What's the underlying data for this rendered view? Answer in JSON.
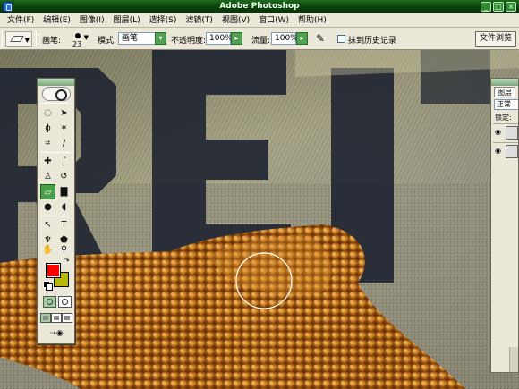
{
  "window": {
    "title": "Adobe Photoshop",
    "controls": [
      "_",
      "□",
      "×"
    ]
  },
  "menu": [
    "文件(F)",
    "编辑(E)",
    "图像(I)",
    "图层(L)",
    "选择(S)",
    "滤镜(T)",
    "视图(V)",
    "窗口(W)",
    "帮助(H)"
  ],
  "options": {
    "brush_label": "画笔:",
    "brush_size": "23",
    "mode_label": "模式:",
    "mode_value": "画笔",
    "opacity_label": "不透明度:",
    "opacity_value": "100%",
    "flow_label": "流量:",
    "flow_value": "100%",
    "erase_history_label": "抹到历史记录",
    "file_browser_label": "文件浏览"
  },
  "toolbox": {
    "tools": [
      "marquee-icon",
      "move-icon",
      "lasso-icon",
      "magic-wand-icon",
      "crop-icon",
      "slice-icon",
      "healing-brush-icon",
      "brush-icon",
      "clone-stamp-icon",
      "history-brush-icon",
      "eraser-icon",
      "gradient-icon",
      "blur-icon",
      "dodge-icon",
      "path-select-icon",
      "type-icon",
      "pen-icon",
      "shape-icon",
      "notes-icon",
      "eyedropper-icon",
      "hand-icon",
      "zoom-icon"
    ],
    "selected_tool": "eraser-icon",
    "foreground_color": "#ff0000",
    "background_color": "#b8b80c"
  },
  "layers_panel": {
    "tab_label": "图层",
    "blend_mode": "正常",
    "lock_label": "锁定:"
  },
  "canvas": {
    "letters_shown": "REI",
    "subject": "starfish on sand"
  }
}
